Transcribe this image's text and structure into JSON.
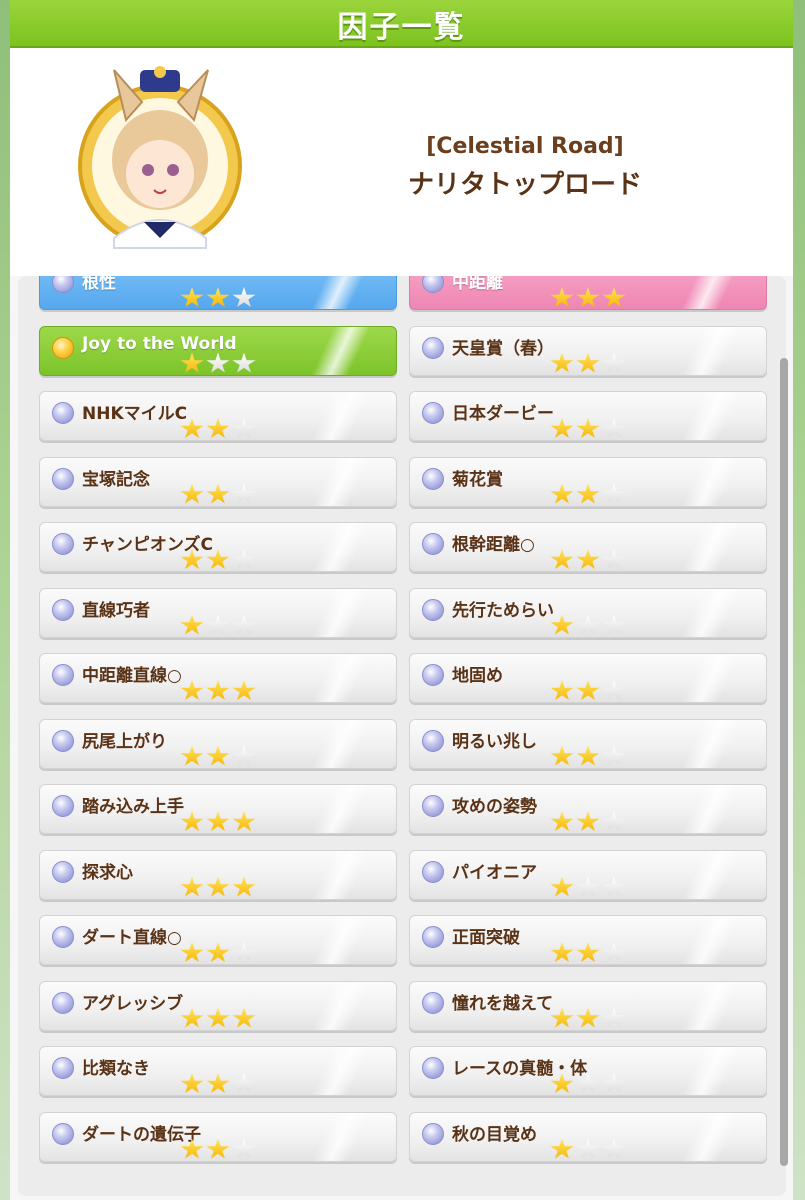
{
  "header": {
    "title": "因子一覧"
  },
  "character": {
    "epithet": "[Celestial Road]",
    "name": "ナリタトップロード"
  },
  "colors": {
    "accent": "#7cc31f",
    "star_on": "#f5b400",
    "text": "#5a3216"
  },
  "factors": {
    "left": [
      {
        "label": "根性",
        "stars": 2,
        "style": "blue"
      },
      {
        "label": "Joy to the World",
        "stars": 1,
        "style": "green"
      },
      {
        "label": "NHKマイルC",
        "stars": 2,
        "style": "normal"
      },
      {
        "label": "宝塚記念",
        "stars": 2,
        "style": "normal"
      },
      {
        "label": "チャンピオンズC",
        "stars": 2,
        "style": "normal"
      },
      {
        "label": "直線巧者",
        "stars": 1,
        "style": "normal"
      },
      {
        "label": "中距離直線○",
        "stars": 3,
        "style": "normal"
      },
      {
        "label": "尻尾上がり",
        "stars": 2,
        "style": "normal"
      },
      {
        "label": "踏み込み上手",
        "stars": 3,
        "style": "normal"
      },
      {
        "label": "探求心",
        "stars": 3,
        "style": "normal"
      },
      {
        "label": "ダート直線○",
        "stars": 2,
        "style": "normal"
      },
      {
        "label": "アグレッシブ",
        "stars": 3,
        "style": "normal"
      },
      {
        "label": "比類なき",
        "stars": 2,
        "style": "normal"
      },
      {
        "label": "ダートの遺伝子",
        "stars": 2,
        "style": "normal"
      }
    ],
    "right": [
      {
        "label": "中距離",
        "stars": 3,
        "style": "pink"
      },
      {
        "label": "天皇賞（春）",
        "stars": 2,
        "style": "normal"
      },
      {
        "label": "日本ダービー",
        "stars": 2,
        "style": "normal"
      },
      {
        "label": "菊花賞",
        "stars": 2,
        "style": "normal"
      },
      {
        "label": "根幹距離○",
        "stars": 2,
        "style": "normal"
      },
      {
        "label": "先行ためらい",
        "stars": 1,
        "style": "normal"
      },
      {
        "label": "地固め",
        "stars": 2,
        "style": "normal"
      },
      {
        "label": "明るい兆し",
        "stars": 2,
        "style": "normal"
      },
      {
        "label": "攻めの姿勢",
        "stars": 2,
        "style": "normal"
      },
      {
        "label": "パイオニア",
        "stars": 1,
        "style": "normal"
      },
      {
        "label": "正面突破",
        "stars": 2,
        "style": "normal"
      },
      {
        "label": "憧れを越えて",
        "stars": 2,
        "style": "normal"
      },
      {
        "label": "レースの真髄・体",
        "stars": 1,
        "style": "normal"
      },
      {
        "label": "秋の目覚め",
        "stars": 1,
        "style": "normal"
      }
    ]
  }
}
